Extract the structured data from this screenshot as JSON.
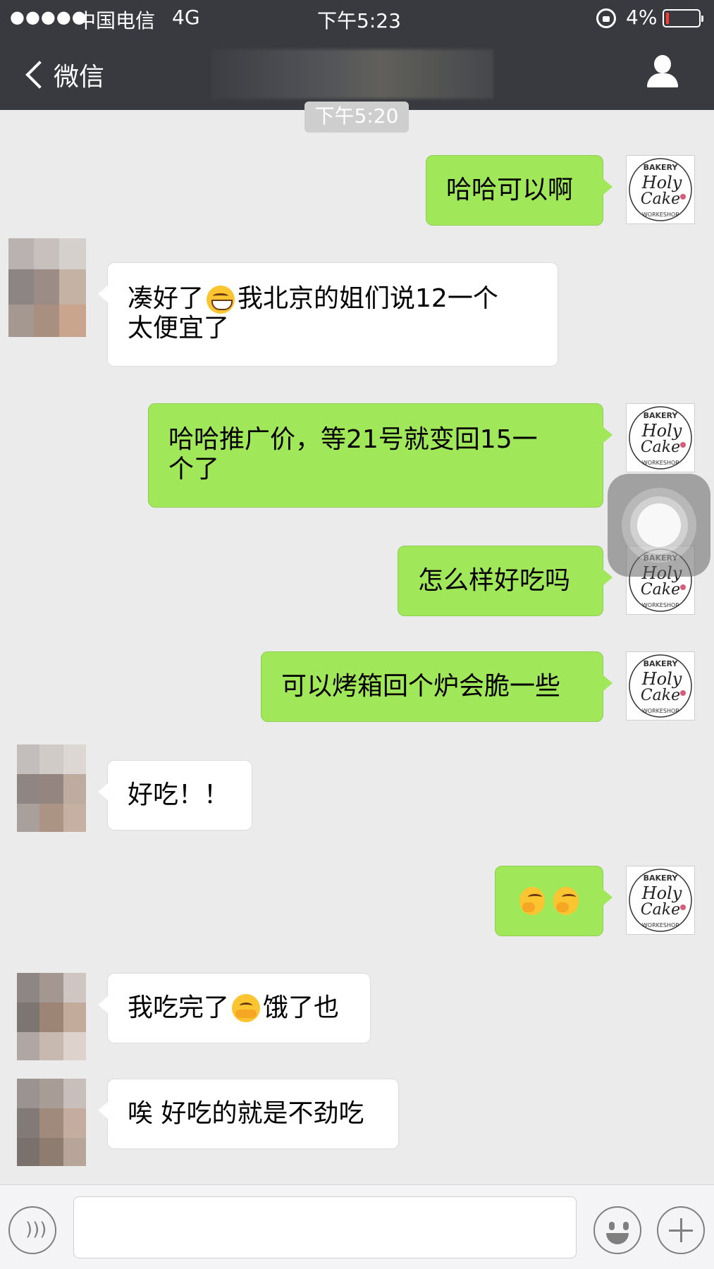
{
  "status_bar": {
    "signal": "●●●●●",
    "carrier": "中国电信",
    "network": "4G",
    "time": "下午5:23",
    "battery_percent": "4%"
  },
  "nav": {
    "back_label": "微信"
  },
  "chat": {
    "timestamp": "下午5:20",
    "messages": [
      {
        "sender": "self",
        "text": "哈哈可以啊"
      },
      {
        "sender": "other",
        "text_before": "凑好了",
        "emoji": "grinning-face",
        "text_after": "我北京的姐们说12一个",
        "line2": "太便宜了"
      },
      {
        "sender": "self",
        "line1": "哈哈推广价，等21号就变回15一",
        "line2": "个了"
      },
      {
        "sender": "self",
        "text": "怎么样好吃吗"
      },
      {
        "sender": "self",
        "text": "可以烤箱回个炉会脆一些"
      },
      {
        "sender": "other",
        "text": "好吃！！"
      },
      {
        "sender": "self",
        "emojis": [
          "thinking-face",
          "thinking-face"
        ]
      },
      {
        "sender": "other",
        "text_before": "我吃完了",
        "emoji": "hugging-face",
        "text_after": "饿了也"
      },
      {
        "sender": "other",
        "text": "唉 好吃的就是不劲吃"
      }
    ]
  },
  "self_avatar": {
    "top": "BAKERY",
    "line1": "Holy",
    "line2": "Cake",
    "bottom": "WORKESHOP"
  },
  "input_bar": {
    "message_value": ""
  },
  "colors": {
    "nav_bg": "#393a3f",
    "chat_bg": "#ebebeb",
    "sent_bubble": "#a0e75a",
    "received_bubble": "#ffffff",
    "battery_low": "#ff3b30"
  }
}
